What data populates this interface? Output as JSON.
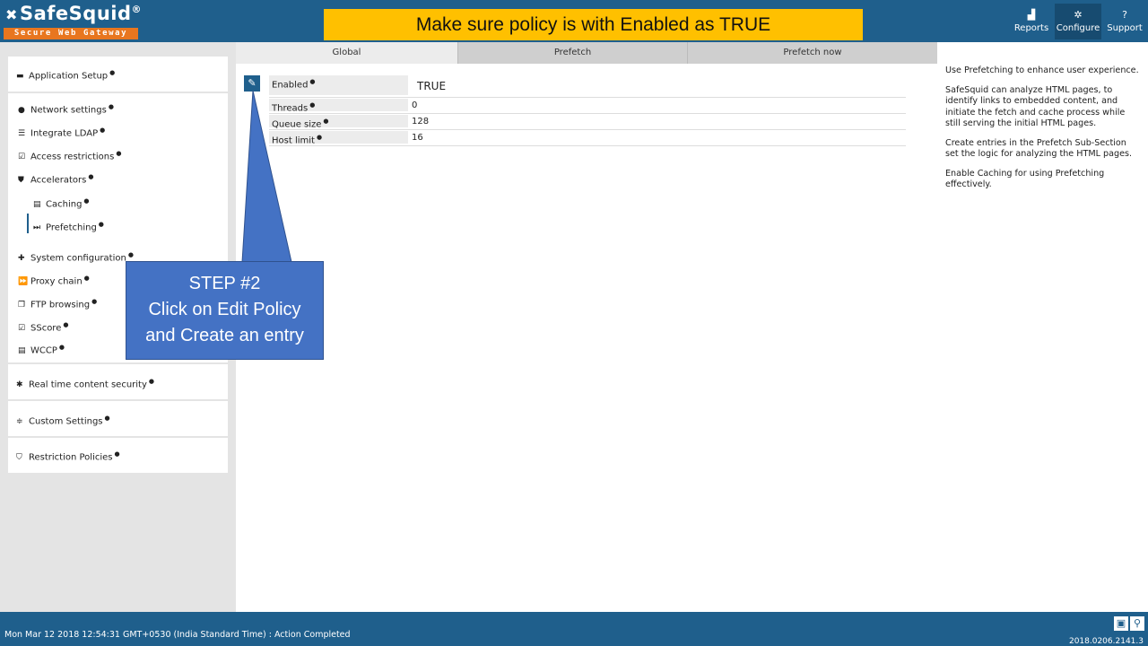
{
  "brand": {
    "name": "SafeSquid",
    "trademark": "®",
    "tagline": "Secure Web Gateway"
  },
  "banner": "Make sure policy is with Enabled as TRUE",
  "top_nav": [
    {
      "label": "Reports",
      "icon": "chart-icon"
    },
    {
      "label": "Configure",
      "icon": "cogs-icon",
      "active": true
    },
    {
      "label": "Support",
      "icon": "question-icon"
    }
  ],
  "sidebar": {
    "application_setup": "Application Setup",
    "network_settings": "Network settings",
    "integrate_ldap": "Integrate LDAP",
    "access_restrictions": "Access restrictions",
    "accelerators": "Accelerators",
    "caching": "Caching",
    "prefetching": "Prefetching",
    "system_configuration": "System configuration",
    "proxy_chain": "Proxy chain",
    "ftp_browsing": "FTP browsing",
    "sscore": "SScore",
    "wccp": "WCCP",
    "real_time_content_security": "Real time content security",
    "custom_settings": "Custom Settings",
    "restriction_policies": "Restriction Policies"
  },
  "tabs": {
    "global": "Global",
    "prefetch": "Prefetch",
    "prefetch_now": "Prefetch now"
  },
  "properties": [
    {
      "label": "Enabled",
      "value": "TRUE"
    },
    {
      "label": "Threads",
      "value": "0"
    },
    {
      "label": "Queue size",
      "value": "128"
    },
    {
      "label": "Host limit",
      "value": "16"
    }
  ],
  "help": {
    "p1": "Use Prefetching to enhance user experience.",
    "p2": "SafeSquid can analyze HTML pages, to identify links to embedded content, and initiate the fetch and cache process while still serving the initial HTML pages.",
    "p3": "Create entries in the Prefetch Sub-Section set the logic for analyzing the HTML pages.",
    "p4": "Enable Caching for using Prefetching effectively."
  },
  "callout": {
    "line1": "STEP #2",
    "line2": "Click on Edit Policy",
    "line3": "and Create an entry"
  },
  "footer": {
    "status": "Mon Mar 12 2018 12:54:31 GMT+0530 (India Standard Time) : Action Completed",
    "version": "2018.0206.2141.3"
  },
  "colors": {
    "primary": "#1f5f8c",
    "banner": "#ffc000",
    "callout": "#4472c4",
    "logo_bar": "#e8761f"
  }
}
